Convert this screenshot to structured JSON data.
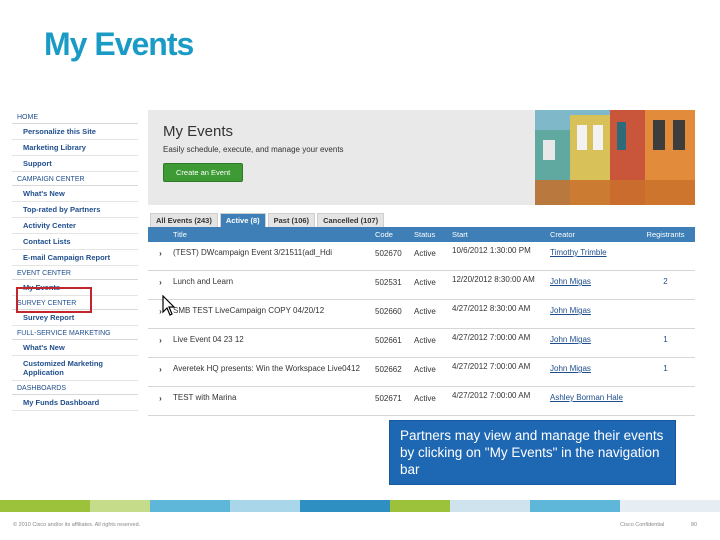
{
  "slide": {
    "title": "My Events"
  },
  "sidebar": {
    "sections": [
      {
        "head": "HOME",
        "items": [
          "Personalize this Site",
          "Marketing Library",
          "Support"
        ]
      },
      {
        "head": "CAMPAIGN CENTER",
        "items": [
          "What's New",
          "Top-rated by Partners",
          "Activity Center",
          "Contact Lists",
          "E-mail Campaign Report"
        ]
      },
      {
        "head": "EVENT CENTER",
        "items": [
          "My Events"
        ]
      },
      {
        "head": "SURVEY CENTER",
        "items": [
          "Survey Report"
        ]
      },
      {
        "head": "FULL-SERVICE MARKETING",
        "items": [
          "What's New",
          "Customized Marketing Application"
        ]
      },
      {
        "head": "DASHBOARDS",
        "items": [
          "My Funds Dashboard"
        ]
      }
    ]
  },
  "banner": {
    "title": "My Events",
    "subtitle": "Easily schedule, execute, and manage your events",
    "create_label": "Create an Event"
  },
  "tabs": [
    "All Events (243)",
    "Active (8)",
    "Past (106)",
    "Cancelled (107)"
  ],
  "table": {
    "columns": [
      "Title",
      "Code",
      "Status",
      "Start",
      "Creator",
      "Registrants"
    ],
    "rows": [
      {
        "title": "(TEST) DWcampaign Event 3/21511(adl_Hdi",
        "code": "502670",
        "status": "Active",
        "start": "10/6/2012 1:30:00 PM",
        "creator": "Timothy Trimble",
        "registrants": ""
      },
      {
        "title": "Lunch and Learn",
        "code": "502531",
        "status": "Active",
        "start": "12/20/2012 8:30:00 AM",
        "creator": "John Migas",
        "registrants": "2"
      },
      {
        "title": "SMB TEST LiveCampaign COPY 04/20/12",
        "code": "502660",
        "status": "Active",
        "start": "4/27/2012 8:30:00 AM",
        "creator": "John Migas",
        "registrants": ""
      },
      {
        "title": "Live Event 04 23 12",
        "code": "502661",
        "status": "Active",
        "start": "4/27/2012 7:00:00 AM",
        "creator": "John Migas",
        "registrants": "1"
      },
      {
        "title": "Averetek HQ presents: Win the Workspace Live0412",
        "code": "502662",
        "status": "Active",
        "start": "4/27/2012 7:00:00 AM",
        "creator": "John Migas",
        "registrants": "1"
      },
      {
        "title": "TEST with Marina",
        "code": "502671",
        "status": "Active",
        "start": "4/27/2012 7:00:00 AM",
        "creator": "Ashley Borman Hale",
        "registrants": ""
      }
    ]
  },
  "callout": {
    "text": "Partners may view and manage their events by clicking on \"My Events\" in the navigation bar"
  },
  "footer": {
    "copyright": "© 2010 Cisco and/or its affiliates. All rights reserved.",
    "confidential": "Cisco Confidential",
    "page": "80"
  },
  "colors": {
    "accent": "#1a9bc6",
    "table_header": "#3d7fb6",
    "highlight": "#c0262b",
    "callout": "#1e67b3",
    "button": "#3e9a35"
  }
}
